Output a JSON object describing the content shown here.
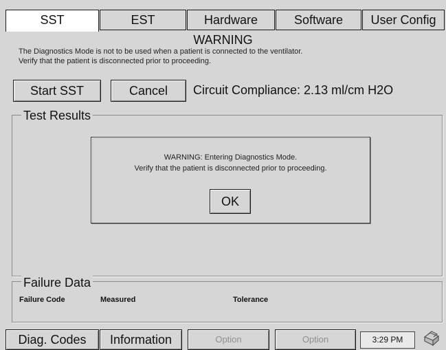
{
  "tabs": [
    {
      "label": "SST",
      "active": true
    },
    {
      "label": "EST",
      "active": false
    },
    {
      "label": "Hardware",
      "active": false
    },
    {
      "label": "Software",
      "active": false
    },
    {
      "label": "User Config",
      "active": false
    }
  ],
  "warning": {
    "title": "WARNING",
    "line1": "The Diagnostics Mode is not to be used when a patient is connected to the ventilator.",
    "line2": "Verify that the patient is disconnected prior to proceeding."
  },
  "controls": {
    "start_label": "Start SST",
    "cancel_label": "Cancel",
    "compliance_text": "Circuit Compliance: 2.13 ml/cm H2O"
  },
  "test_results": {
    "title": "Test Results"
  },
  "dialog": {
    "line1": "WARNING: Entering Diagnostics Mode.",
    "line2": "Verify that the patient is disconnected prior to proceeding.",
    "ok_label": "OK"
  },
  "failure_data": {
    "title": "Failure Data",
    "columns": [
      "Failure Code",
      "Measured",
      "Tolerance"
    ]
  },
  "bottom_bar": {
    "diag_codes_label": "Diag. Codes",
    "information_label": "Information",
    "option1_label": "Option",
    "option2_label": "Option",
    "time": "3:29 PM",
    "printer_icon": "printer-icon"
  }
}
